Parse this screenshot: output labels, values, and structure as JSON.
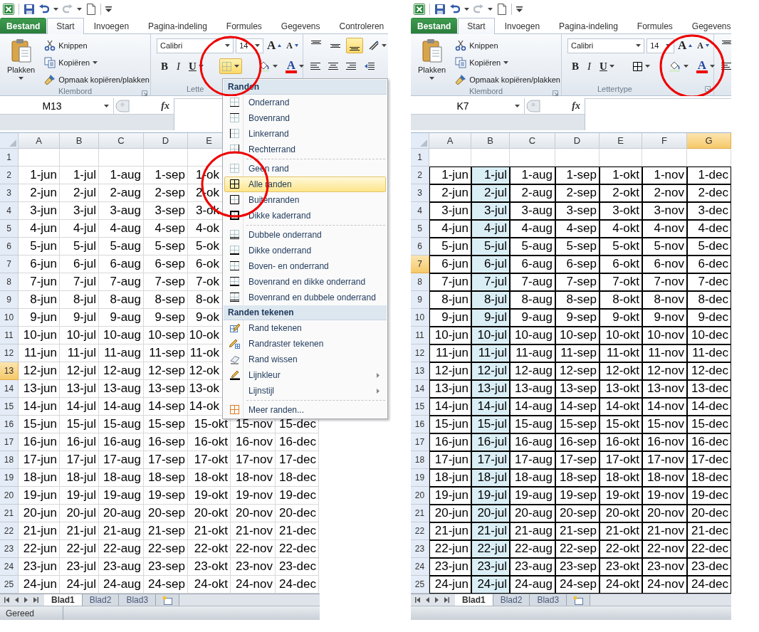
{
  "panels": [
    {
      "tabs": [
        {
          "label": "Bestand",
          "kind": "file",
          "selected": false
        },
        {
          "label": "Start",
          "kind": "tab",
          "selected": true
        },
        {
          "label": "Invoegen",
          "kind": "tab",
          "selected": false
        },
        {
          "label": "Pagina-indeling",
          "kind": "tab",
          "selected": false
        },
        {
          "label": "Formules",
          "kind": "tab",
          "selected": false
        },
        {
          "label": "Gegevens",
          "kind": "tab",
          "selected": false
        },
        {
          "label": "Controleren",
          "kind": "tab",
          "selected": false
        }
      ],
      "clipboard": {
        "paste": "Plakken",
        "cut": "Knippen",
        "copy": "Kopiëren",
        "format_painter": "Opmaak kopiëren/plakken",
        "group_label": "Klembord"
      },
      "font": {
        "name": "Calibri",
        "size": "14",
        "grow": "A",
        "shrink": "A",
        "bold": "B",
        "italic": "I",
        "underline": "U",
        "font_color": "A",
        "group_label": "Lette",
        "borders_pressed": true,
        "borders_circled": true,
        "colors_circled": false
      },
      "alignment": [
        {
          "kind": "top",
          "pressed": false
        },
        {
          "kind": "middle",
          "pressed": false
        },
        {
          "kind": "bottom",
          "pressed": true
        }
      ],
      "name_box": "M13",
      "formula_button": "fx",
      "columns": [
        {
          "label": "A",
          "highlighted": false,
          "shaded": false
        },
        {
          "label": "B",
          "highlighted": false,
          "shaded": false
        },
        {
          "label": "C",
          "highlighted": false,
          "shaded": false
        },
        {
          "label": "D",
          "highlighted": false,
          "shaded": false
        },
        {
          "label": "E",
          "highlighted": false,
          "shaded": false
        }
      ],
      "rows": [
        {
          "label": "1",
          "highlighted": false,
          "bordered": false,
          "cells": []
        },
        {
          "label": "2",
          "highlighted": false,
          "bordered": false,
          "cells": [
            "1-jun",
            "1-jul",
            "1-aug",
            "1-sep",
            "1-ok"
          ]
        },
        {
          "label": "3",
          "highlighted": false,
          "bordered": false,
          "cells": [
            "2-jun",
            "2-jul",
            "2-aug",
            "2-sep",
            "2-ok"
          ]
        },
        {
          "label": "4",
          "highlighted": false,
          "bordered": false,
          "cells": [
            "3-jun",
            "3-jul",
            "3-aug",
            "3-sep",
            "3-ok"
          ]
        },
        {
          "label": "5",
          "highlighted": false,
          "bordered": false,
          "cells": [
            "4-jun",
            "4-jul",
            "4-aug",
            "4-sep",
            "4-ok"
          ]
        },
        {
          "label": "6",
          "highlighted": false,
          "bordered": false,
          "cells": [
            "5-jun",
            "5-jul",
            "5-aug",
            "5-sep",
            "5-ok"
          ]
        },
        {
          "label": "7",
          "highlighted": false,
          "bordered": false,
          "cells": [
            "6-jun",
            "6-jul",
            "6-aug",
            "6-sep",
            "6-ok"
          ]
        },
        {
          "label": "8",
          "highlighted": false,
          "bordered": false,
          "cells": [
            "7-jun",
            "7-jul",
            "7-aug",
            "7-sep",
            "7-ok"
          ]
        },
        {
          "label": "9",
          "highlighted": false,
          "bordered": false,
          "cells": [
            "8-jun",
            "8-jul",
            "8-aug",
            "8-sep",
            "8-ok"
          ]
        },
        {
          "label": "10",
          "highlighted": false,
          "bordered": false,
          "cells": [
            "9-jun",
            "9-jul",
            "9-aug",
            "9-sep",
            "9-ok"
          ]
        },
        {
          "label": "11",
          "highlighted": false,
          "bordered": false,
          "cells": [
            "10-jun",
            "10-jul",
            "10-aug",
            "10-sep",
            "10-ok"
          ]
        },
        {
          "label": "12",
          "highlighted": false,
          "bordered": false,
          "cells": [
            "11-jun",
            "11-jul",
            "11-aug",
            "11-sep",
            "11-ok"
          ]
        },
        {
          "label": "13",
          "highlighted": true,
          "bordered": false,
          "cells": [
            "12-jun",
            "12-jul",
            "12-aug",
            "12-sep",
            "12-ok"
          ]
        },
        {
          "label": "14",
          "highlighted": false,
          "bordered": false,
          "cells": [
            "13-jun",
            "13-jul",
            "13-aug",
            "13-sep",
            "13-ok"
          ]
        },
        {
          "label": "15",
          "highlighted": false,
          "bordered": false,
          "cells": [
            "14-jun",
            "14-jul",
            "14-aug",
            "14-sep",
            "14-ok"
          ]
        },
        {
          "label": "16",
          "highlighted": false,
          "bordered": false,
          "cells": [
            "15-jun",
            "15-jul",
            "15-aug",
            "15-sep",
            "15-okt",
            "15-nov",
            "15-dec"
          ]
        },
        {
          "label": "17",
          "highlighted": false,
          "bordered": false,
          "cells": [
            "16-jun",
            "16-jul",
            "16-aug",
            "16-sep",
            "16-okt",
            "16-nov",
            "16-dec"
          ]
        },
        {
          "label": "18",
          "highlighted": false,
          "bordered": false,
          "cells": [
            "17-jun",
            "17-jul",
            "17-aug",
            "17-sep",
            "17-okt",
            "17-nov",
            "17-dec"
          ]
        },
        {
          "label": "19",
          "highlighted": false,
          "bordered": false,
          "cells": [
            "18-jun",
            "18-jul",
            "18-aug",
            "18-sep",
            "18-okt",
            "18-nov",
            "18-dec"
          ]
        },
        {
          "label": "20",
          "highlighted": false,
          "bordered": false,
          "cells": [
            "19-jun",
            "19-jul",
            "19-aug",
            "19-sep",
            "19-okt",
            "19-nov",
            "19-dec"
          ]
        },
        {
          "label": "21",
          "highlighted": false,
          "bordered": false,
          "cells": [
            "20-jun",
            "20-jul",
            "20-aug",
            "20-sep",
            "20-okt",
            "20-nov",
            "20-dec"
          ]
        },
        {
          "label": "22",
          "highlighted": false,
          "bordered": false,
          "cells": [
            "21-jun",
            "21-jul",
            "21-aug",
            "21-sep",
            "21-okt",
            "21-nov",
            "21-dec"
          ]
        },
        {
          "label": "23",
          "highlighted": false,
          "bordered": false,
          "cells": [
            "22-jun",
            "22-jul",
            "22-aug",
            "22-sep",
            "22-okt",
            "22-nov",
            "22-dec"
          ]
        },
        {
          "label": "24",
          "highlighted": false,
          "bordered": false,
          "cells": [
            "23-jun",
            "23-jul",
            "23-aug",
            "23-sep",
            "23-okt",
            "23-nov",
            "23-dec"
          ]
        },
        {
          "label": "25",
          "highlighted": false,
          "bordered": false,
          "cells": [
            "24-jun",
            "24-jul",
            "24-aug",
            "24-sep",
            "24-okt",
            "24-nov",
            "24-dec"
          ]
        }
      ],
      "sheet_tabs": [
        {
          "label": "Blad1",
          "selected": true
        },
        {
          "label": "Blad2",
          "selected": false
        },
        {
          "label": "Blad3",
          "selected": false
        }
      ],
      "status": "Gereed",
      "border_menu": {
        "sections": [
          {
            "title": "Randen",
            "groups": [
              [
                {
                  "label": "Onderrand",
                  "kind": "bottom",
                  "selected": false,
                  "submenu": false,
                  "circled": false
                },
                {
                  "label": "Bovenrand",
                  "kind": "top",
                  "selected": false,
                  "submenu": false,
                  "circled": false
                },
                {
                  "label": "Linkerrand",
                  "kind": "left",
                  "selected": false,
                  "submenu": false,
                  "circled": false
                },
                {
                  "label": "Rechterrand",
                  "kind": "right",
                  "selected": false,
                  "submenu": false,
                  "circled": false
                }
              ],
              [
                {
                  "label": "Geen rand",
                  "kind": "none",
                  "selected": false,
                  "submenu": false,
                  "circled": false
                },
                {
                  "label": "Alle randen",
                  "kind": "all",
                  "selected": true,
                  "submenu": false,
                  "circled": true
                },
                {
                  "label": "Buitenranden",
                  "kind": "outside",
                  "selected": false,
                  "submenu": false,
                  "circled": false
                },
                {
                  "label": "Dikke kaderrand",
                  "kind": "thick-box",
                  "selected": false,
                  "submenu": false,
                  "circled": false
                }
              ],
              [
                {
                  "label": "Dubbele onderrand",
                  "kind": "double-bottom",
                  "selected": false,
                  "submenu": false,
                  "circled": false
                },
                {
                  "label": "Dikke onderrand",
                  "kind": "thick-bottom",
                  "selected": false,
                  "submenu": false,
                  "circled": false
                },
                {
                  "label": "Boven- en onderrand",
                  "kind": "top-bottom",
                  "selected": false,
                  "submenu": false,
                  "circled": false
                },
                {
                  "label": "Bovenrand en dikke onderrand",
                  "kind": "top-thick-bottom",
                  "selected": false,
                  "submenu": false,
                  "circled": false
                },
                {
                  "label": "Bovenrand en dubbele onderrand",
                  "kind": "top-double-bottom",
                  "selected": false,
                  "submenu": false,
                  "circled": false
                }
              ]
            ]
          },
          {
            "title": "Randen tekenen",
            "groups": [
              [
                {
                  "label": "Rand tekenen",
                  "kind": "draw",
                  "selected": false,
                  "submenu": false,
                  "circled": false
                },
                {
                  "label": "Randraster tekenen",
                  "kind": "draw-grid",
                  "selected": false,
                  "submenu": false,
                  "circled": false
                },
                {
                  "label": "Rand wissen",
                  "kind": "erase",
                  "selected": false,
                  "submenu": false,
                  "circled": false
                },
                {
                  "label": "Lijnkleur",
                  "kind": "line-color",
                  "selected": false,
                  "submenu": true,
                  "circled": false
                },
                {
                  "label": "Lijnstijl",
                  "kind": "line-style",
                  "selected": false,
                  "submenu": true,
                  "circled": false
                }
              ],
              [
                {
                  "label": "Meer randen...",
                  "kind": "more",
                  "selected": false,
                  "submenu": false,
                  "circled": false
                }
              ]
            ]
          }
        ]
      }
    },
    {
      "tabs": [
        {
          "label": "Bestand",
          "kind": "file",
          "selected": false
        },
        {
          "label": "Start",
          "kind": "tab",
          "selected": true
        },
        {
          "label": "Invoegen",
          "kind": "tab",
          "selected": false
        },
        {
          "label": "Pagina-indeling",
          "kind": "tab",
          "selected": false
        },
        {
          "label": "Formules",
          "kind": "tab",
          "selected": false
        },
        {
          "label": "Gegevens",
          "kind": "tab",
          "selected": false
        }
      ],
      "clipboard": {
        "paste": "Plakken",
        "cut": "Knippen",
        "copy": "Kopiëren",
        "format_painter": "Opmaak kopiëren/plakken",
        "group_label": "Klembord"
      },
      "font": {
        "name": "Calibri",
        "size": "14",
        "grow": "A",
        "shrink": "A",
        "bold": "B",
        "italic": "I",
        "underline": "U",
        "font_color": "A",
        "group_label": "Lettertype",
        "borders_pressed": false,
        "borders_circled": false,
        "colors_circled": true
      },
      "alignment": [
        {
          "kind": "top",
          "pressed": false
        }
      ],
      "name_box": "K7",
      "formula_button": "fx",
      "columns": [
        {
          "label": "A",
          "highlighted": false,
          "shaded": false
        },
        {
          "label": "B",
          "highlighted": false,
          "shaded": true
        },
        {
          "label": "C",
          "highlighted": false,
          "shaded": false
        },
        {
          "label": "D",
          "highlighted": false,
          "shaded": false
        },
        {
          "label": "E",
          "highlighted": false,
          "shaded": false
        },
        {
          "label": "F",
          "highlighted": false,
          "shaded": false
        },
        {
          "label": "G",
          "highlighted": true,
          "shaded": false
        }
      ],
      "rows": [
        {
          "label": "1",
          "highlighted": false,
          "bordered": false,
          "cells": []
        },
        {
          "label": "2",
          "highlighted": false,
          "bordered": true,
          "cells": [
            "1-jun",
            "1-jul",
            "1-aug",
            "1-sep",
            "1-okt",
            "1-nov",
            "1-dec"
          ]
        },
        {
          "label": "3",
          "highlighted": false,
          "bordered": true,
          "cells": [
            "2-jun",
            "2-jul",
            "2-aug",
            "2-sep",
            "2-okt",
            "2-nov",
            "2-dec"
          ]
        },
        {
          "label": "4",
          "highlighted": false,
          "bordered": true,
          "cells": [
            "3-jun",
            "3-jul",
            "3-aug",
            "3-sep",
            "3-okt",
            "3-nov",
            "3-dec"
          ]
        },
        {
          "label": "5",
          "highlighted": false,
          "bordered": true,
          "cells": [
            "4-jun",
            "4-jul",
            "4-aug",
            "4-sep",
            "4-okt",
            "4-nov",
            "4-dec"
          ]
        },
        {
          "label": "6",
          "highlighted": false,
          "bordered": true,
          "cells": [
            "5-jun",
            "5-jul",
            "5-aug",
            "5-sep",
            "5-okt",
            "5-nov",
            "5-dec"
          ]
        },
        {
          "label": "7",
          "highlighted": true,
          "bordered": true,
          "cells": [
            "6-jun",
            "6-jul",
            "6-aug",
            "6-sep",
            "6-okt",
            "6-nov",
            "6-dec"
          ]
        },
        {
          "label": "8",
          "highlighted": false,
          "bordered": true,
          "cells": [
            "7-jun",
            "7-jul",
            "7-aug",
            "7-sep",
            "7-okt",
            "7-nov",
            "7-dec"
          ]
        },
        {
          "label": "9",
          "highlighted": false,
          "bordered": true,
          "cells": [
            "8-jun",
            "8-jul",
            "8-aug",
            "8-sep",
            "8-okt",
            "8-nov",
            "8-dec"
          ]
        },
        {
          "label": "10",
          "highlighted": false,
          "bordered": true,
          "cells": [
            "9-jun",
            "9-jul",
            "9-aug",
            "9-sep",
            "9-okt",
            "9-nov",
            "9-dec"
          ]
        },
        {
          "label": "11",
          "highlighted": false,
          "bordered": true,
          "cells": [
            "10-jun",
            "10-jul",
            "10-aug",
            "10-sep",
            "10-okt",
            "10-nov",
            "10-dec"
          ]
        },
        {
          "label": "12",
          "highlighted": false,
          "bordered": true,
          "cells": [
            "11-jun",
            "11-jul",
            "11-aug",
            "11-sep",
            "11-okt",
            "11-nov",
            "11-dec"
          ]
        },
        {
          "label": "13",
          "highlighted": false,
          "bordered": true,
          "cells": [
            "12-jun",
            "12-jul",
            "12-aug",
            "12-sep",
            "12-okt",
            "12-nov",
            "12-dec"
          ]
        },
        {
          "label": "14",
          "highlighted": false,
          "bordered": true,
          "cells": [
            "13-jun",
            "13-jul",
            "13-aug",
            "13-sep",
            "13-okt",
            "13-nov",
            "13-dec"
          ]
        },
        {
          "label": "15",
          "highlighted": false,
          "bordered": true,
          "cells": [
            "14-jun",
            "14-jul",
            "14-aug",
            "14-sep",
            "14-okt",
            "14-nov",
            "14-dec"
          ]
        },
        {
          "label": "16",
          "highlighted": false,
          "bordered": true,
          "cells": [
            "15-jun",
            "15-jul",
            "15-aug",
            "15-sep",
            "15-okt",
            "15-nov",
            "15-dec"
          ]
        },
        {
          "label": "17",
          "highlighted": false,
          "bordered": true,
          "cells": [
            "16-jun",
            "16-jul",
            "16-aug",
            "16-sep",
            "16-okt",
            "16-nov",
            "16-dec"
          ]
        },
        {
          "label": "18",
          "highlighted": false,
          "bordered": true,
          "cells": [
            "17-jun",
            "17-jul",
            "17-aug",
            "17-sep",
            "17-okt",
            "17-nov",
            "17-dec"
          ]
        },
        {
          "label": "19",
          "highlighted": false,
          "bordered": true,
          "cells": [
            "18-jun",
            "18-jul",
            "18-aug",
            "18-sep",
            "18-okt",
            "18-nov",
            "18-dec"
          ]
        },
        {
          "label": "20",
          "highlighted": false,
          "bordered": true,
          "cells": [
            "19-jun",
            "19-jul",
            "19-aug",
            "19-sep",
            "19-okt",
            "19-nov",
            "19-dec"
          ]
        },
        {
          "label": "21",
          "highlighted": false,
          "bordered": true,
          "cells": [
            "20-jun",
            "20-jul",
            "20-aug",
            "20-sep",
            "20-okt",
            "20-nov",
            "20-dec"
          ]
        },
        {
          "label": "22",
          "highlighted": false,
          "bordered": true,
          "cells": [
            "21-jun",
            "21-jul",
            "21-aug",
            "21-sep",
            "21-okt",
            "21-nov",
            "21-dec"
          ]
        },
        {
          "label": "23",
          "highlighted": false,
          "bordered": true,
          "cells": [
            "22-jun",
            "22-jul",
            "22-aug",
            "22-sep",
            "22-okt",
            "22-nov",
            "22-dec"
          ]
        },
        {
          "label": "24",
          "highlighted": false,
          "bordered": true,
          "cells": [
            "23-jun",
            "23-jul",
            "23-aug",
            "23-sep",
            "23-okt",
            "23-nov",
            "23-dec"
          ]
        },
        {
          "label": "25",
          "highlighted": false,
          "bordered": true,
          "cells": [
            "24-jun",
            "24-jul",
            "24-aug",
            "24-sep",
            "24-okt",
            "24-nov",
            "24-dec"
          ]
        }
      ],
      "sheet_tabs": [
        {
          "label": "Blad1",
          "selected": true
        },
        {
          "label": "Blad2",
          "selected": false
        },
        {
          "label": "Blad3",
          "selected": false
        }
      ]
    }
  ]
}
